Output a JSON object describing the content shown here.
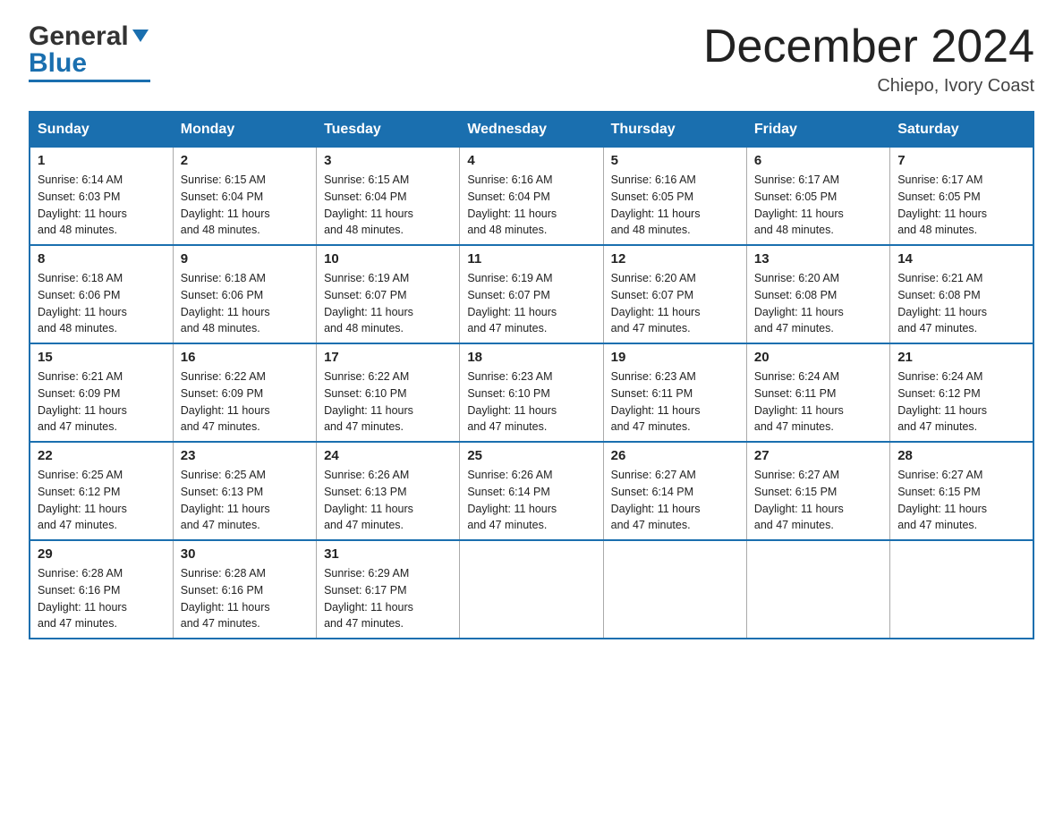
{
  "header": {
    "logo_general": "General",
    "logo_blue": "Blue",
    "month_title": "December 2024",
    "location": "Chiepo, Ivory Coast"
  },
  "days_of_week": [
    "Sunday",
    "Monday",
    "Tuesday",
    "Wednesday",
    "Thursday",
    "Friday",
    "Saturday"
  ],
  "weeks": [
    [
      {
        "day": "1",
        "sunrise": "6:14 AM",
        "sunset": "6:03 PM",
        "daylight": "11 hours and 48 minutes."
      },
      {
        "day": "2",
        "sunrise": "6:15 AM",
        "sunset": "6:04 PM",
        "daylight": "11 hours and 48 minutes."
      },
      {
        "day": "3",
        "sunrise": "6:15 AM",
        "sunset": "6:04 PM",
        "daylight": "11 hours and 48 minutes."
      },
      {
        "day": "4",
        "sunrise": "6:16 AM",
        "sunset": "6:04 PM",
        "daylight": "11 hours and 48 minutes."
      },
      {
        "day": "5",
        "sunrise": "6:16 AM",
        "sunset": "6:05 PM",
        "daylight": "11 hours and 48 minutes."
      },
      {
        "day": "6",
        "sunrise": "6:17 AM",
        "sunset": "6:05 PM",
        "daylight": "11 hours and 48 minutes."
      },
      {
        "day": "7",
        "sunrise": "6:17 AM",
        "sunset": "6:05 PM",
        "daylight": "11 hours and 48 minutes."
      }
    ],
    [
      {
        "day": "8",
        "sunrise": "6:18 AM",
        "sunset": "6:06 PM",
        "daylight": "11 hours and 48 minutes."
      },
      {
        "day": "9",
        "sunrise": "6:18 AM",
        "sunset": "6:06 PM",
        "daylight": "11 hours and 48 minutes."
      },
      {
        "day": "10",
        "sunrise": "6:19 AM",
        "sunset": "6:07 PM",
        "daylight": "11 hours and 48 minutes."
      },
      {
        "day": "11",
        "sunrise": "6:19 AM",
        "sunset": "6:07 PM",
        "daylight": "11 hours and 47 minutes."
      },
      {
        "day": "12",
        "sunrise": "6:20 AM",
        "sunset": "6:07 PM",
        "daylight": "11 hours and 47 minutes."
      },
      {
        "day": "13",
        "sunrise": "6:20 AM",
        "sunset": "6:08 PM",
        "daylight": "11 hours and 47 minutes."
      },
      {
        "day": "14",
        "sunrise": "6:21 AM",
        "sunset": "6:08 PM",
        "daylight": "11 hours and 47 minutes."
      }
    ],
    [
      {
        "day": "15",
        "sunrise": "6:21 AM",
        "sunset": "6:09 PM",
        "daylight": "11 hours and 47 minutes."
      },
      {
        "day": "16",
        "sunrise": "6:22 AM",
        "sunset": "6:09 PM",
        "daylight": "11 hours and 47 minutes."
      },
      {
        "day": "17",
        "sunrise": "6:22 AM",
        "sunset": "6:10 PM",
        "daylight": "11 hours and 47 minutes."
      },
      {
        "day": "18",
        "sunrise": "6:23 AM",
        "sunset": "6:10 PM",
        "daylight": "11 hours and 47 minutes."
      },
      {
        "day": "19",
        "sunrise": "6:23 AM",
        "sunset": "6:11 PM",
        "daylight": "11 hours and 47 minutes."
      },
      {
        "day": "20",
        "sunrise": "6:24 AM",
        "sunset": "6:11 PM",
        "daylight": "11 hours and 47 minutes."
      },
      {
        "day": "21",
        "sunrise": "6:24 AM",
        "sunset": "6:12 PM",
        "daylight": "11 hours and 47 minutes."
      }
    ],
    [
      {
        "day": "22",
        "sunrise": "6:25 AM",
        "sunset": "6:12 PM",
        "daylight": "11 hours and 47 minutes."
      },
      {
        "day": "23",
        "sunrise": "6:25 AM",
        "sunset": "6:13 PM",
        "daylight": "11 hours and 47 minutes."
      },
      {
        "day": "24",
        "sunrise": "6:26 AM",
        "sunset": "6:13 PM",
        "daylight": "11 hours and 47 minutes."
      },
      {
        "day": "25",
        "sunrise": "6:26 AM",
        "sunset": "6:14 PM",
        "daylight": "11 hours and 47 minutes."
      },
      {
        "day": "26",
        "sunrise": "6:27 AM",
        "sunset": "6:14 PM",
        "daylight": "11 hours and 47 minutes."
      },
      {
        "day": "27",
        "sunrise": "6:27 AM",
        "sunset": "6:15 PM",
        "daylight": "11 hours and 47 minutes."
      },
      {
        "day": "28",
        "sunrise": "6:27 AM",
        "sunset": "6:15 PM",
        "daylight": "11 hours and 47 minutes."
      }
    ],
    [
      {
        "day": "29",
        "sunrise": "6:28 AM",
        "sunset": "6:16 PM",
        "daylight": "11 hours and 47 minutes."
      },
      {
        "day": "30",
        "sunrise": "6:28 AM",
        "sunset": "6:16 PM",
        "daylight": "11 hours and 47 minutes."
      },
      {
        "day": "31",
        "sunrise": "6:29 AM",
        "sunset": "6:17 PM",
        "daylight": "11 hours and 47 minutes."
      },
      null,
      null,
      null,
      null
    ]
  ],
  "labels": {
    "sunrise": "Sunrise:",
    "sunset": "Sunset:",
    "daylight": "Daylight:"
  }
}
